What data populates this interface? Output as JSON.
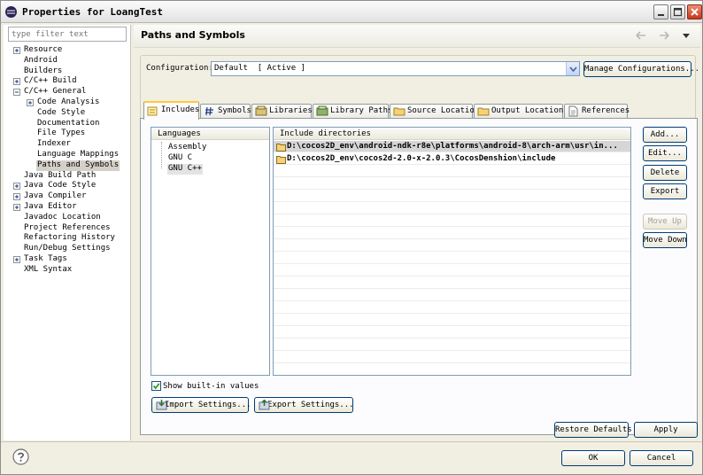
{
  "window": {
    "title": "Properties for LoangTest",
    "minimize_icon": "minimize-icon",
    "maximize_icon": "maximize-icon",
    "close_icon": "close-icon"
  },
  "sidebar": {
    "filter_placeholder": "type filter text",
    "items": [
      {
        "label": "Resource",
        "expander": "plus"
      },
      {
        "label": "Android",
        "expander": null
      },
      {
        "label": "Builders",
        "expander": null
      },
      {
        "label": "C/C++ Build",
        "expander": "plus"
      },
      {
        "label": "C/C++ General",
        "expander": "minus"
      },
      {
        "label": "Code Analysis",
        "expander": "plus"
      },
      {
        "label": "Code Style",
        "expander": null
      },
      {
        "label": "Documentation",
        "expander": null
      },
      {
        "label": "File Types",
        "expander": null
      },
      {
        "label": "Indexer",
        "expander": null
      },
      {
        "label": "Language Mappings",
        "expander": null
      },
      {
        "label": "Paths and Symbols",
        "expander": null,
        "selected": true
      },
      {
        "label": "Java Build Path",
        "expander": null
      },
      {
        "label": "Java Code Style",
        "expander": "plus"
      },
      {
        "label": "Java Compiler",
        "expander": "plus"
      },
      {
        "label": "Java Editor",
        "expander": "plus"
      },
      {
        "label": "Javadoc Location",
        "expander": null
      },
      {
        "label": "Project References",
        "expander": null
      },
      {
        "label": "Refactoring History",
        "expander": null
      },
      {
        "label": "Run/Debug Settings",
        "expander": null
      },
      {
        "label": "Task Tags",
        "expander": "plus"
      },
      {
        "label": "XML Syntax",
        "expander": null
      }
    ]
  },
  "main": {
    "title": "Paths and Symbols",
    "configuration_label": "Configuration:",
    "configuration_value": "Default  [ Active ]",
    "manage_configurations": "Manage Configurations...",
    "tabs": [
      {
        "label": "Includes",
        "icon": "includes-icon",
        "active": true
      },
      {
        "label": "Symbols",
        "icon": "hash-icon"
      },
      {
        "label": "Libraries",
        "icon": "library-icon"
      },
      {
        "label": "Library Paths",
        "icon": "library-path-icon"
      },
      {
        "label": "Source Location",
        "icon": "folder-icon"
      },
      {
        "label": "Output Location",
        "icon": "folder-icon"
      },
      {
        "label": "References",
        "icon": "document-icon"
      }
    ],
    "languages_header": "Languages",
    "languages": [
      "Assembly",
      "GNU C",
      "GNU C++"
    ],
    "includes_header": "Include directories",
    "include_dirs": [
      "D:\\cocos2D_env\\android-ndk-r8e\\platforms\\android-8\\arch-arm\\usr\\in...",
      "D:\\cocos2D_env\\cocos2d-2.0-x-2.0.3\\CocosDenshion\\include"
    ],
    "side_buttons": {
      "add": "Add...",
      "edit": "Edit...",
      "delete": "Delete",
      "export": "Export",
      "move_up": "Move Up",
      "move_down": "Move Down"
    },
    "show_builtin_label": "Show built-in values",
    "show_builtin_checked": true,
    "import_settings": "Import Settings...",
    "export_settings": "Export Settings...",
    "restore_defaults": "Restore Defaults",
    "apply": "Apply"
  },
  "footer": {
    "ok": "OK",
    "cancel": "Cancel",
    "help_icon": "help-icon"
  }
}
